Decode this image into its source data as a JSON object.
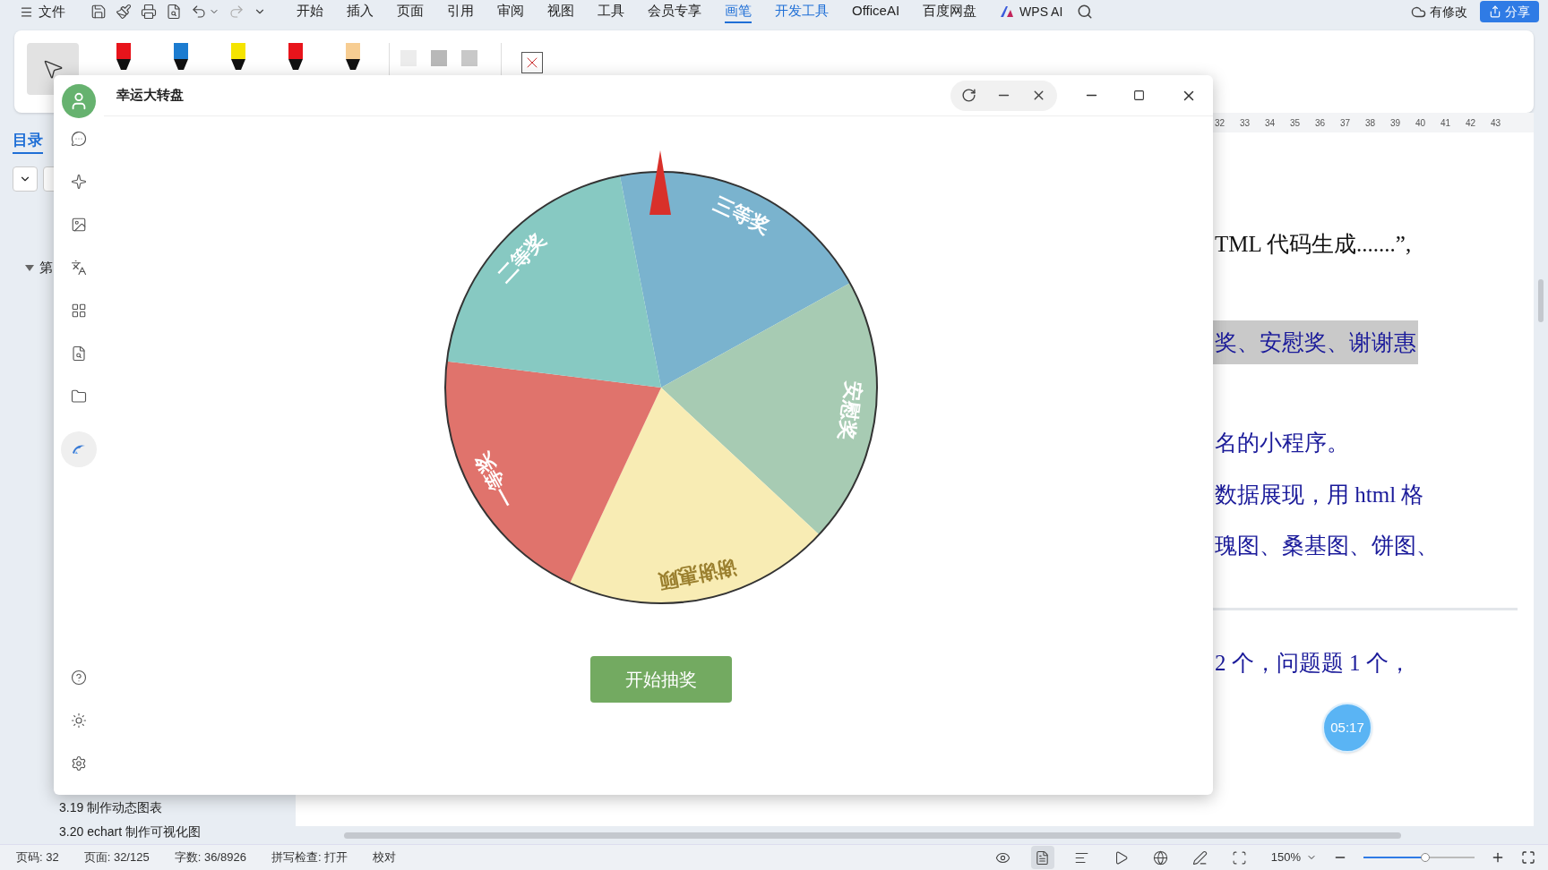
{
  "menu_bar": {
    "file": "文件",
    "menus": [
      {
        "label": "开始",
        "selected": false,
        "accent": false
      },
      {
        "label": "插入",
        "selected": false,
        "accent": false
      },
      {
        "label": "页面",
        "selected": false,
        "accent": false
      },
      {
        "label": "引用",
        "selected": false,
        "accent": false
      },
      {
        "label": "审阅",
        "selected": false,
        "accent": false
      },
      {
        "label": "视图",
        "selected": false,
        "accent": false
      },
      {
        "label": "工具",
        "selected": false,
        "accent": false
      },
      {
        "label": "会员专享",
        "selected": false,
        "accent": false
      },
      {
        "label": "画笔",
        "selected": true,
        "accent": true
      },
      {
        "label": "开发工具",
        "selected": false,
        "accent": true
      },
      {
        "label": "OfficeAI",
        "selected": false,
        "accent": false
      },
      {
        "label": "百度网盘",
        "selected": false,
        "accent": false
      }
    ],
    "ai": "WPS AI",
    "save_status": "有修改",
    "share": "分享"
  },
  "pen_toolbar": {
    "pens": [
      {
        "color": "#e8141b"
      },
      {
        "color": "#1c7cd0"
      },
      {
        "color": "#f5e400"
      },
      {
        "color": "#e8141b"
      },
      {
        "color": "#f7cd92"
      }
    ],
    "swatches": [
      {
        "color": "#ececec"
      },
      {
        "color": "#b8b8b8"
      },
      {
        "color": "#c8c8c8"
      }
    ]
  },
  "outline": {
    "title": "目录",
    "chapter": {
      "label": "第",
      "expanded": true
    },
    "sections": [
      "3.19 制作动态图表",
      "3.20 echart 制作可视化图"
    ]
  },
  "ruler": [
    "32",
    "33",
    "34",
    "35",
    "36",
    "37",
    "38",
    "39",
    "40",
    "41",
    "42",
    "43"
  ],
  "document": {
    "lines": [
      {
        "text": "TML 代码生成.......”,",
        "color": "#111111",
        "highlighted": false,
        "page_break_before": false
      },
      {
        "text": "奖、安慰奖、谢谢惠",
        "color": "#1a1a9a",
        "highlighted": true,
        "page_break_before": false
      },
      {
        "text": "名的小程序。",
        "color": "#1a1a9a",
        "highlighted": false,
        "page_break_before": false
      },
      {
        "text": "数据展现，用 html 格",
        "color": "#1a1a9a",
        "highlighted": false,
        "page_break_before": false
      },
      {
        "text": "瑰图、桑基图、饼图、",
        "color": "#1a1a9a",
        "highlighted": false,
        "page_break_before": false
      },
      {
        "text": "2 个，问题题 1 个，",
        "color": "#1a1a9a",
        "highlighted": false,
        "page_break_before": true
      }
    ],
    "timer": "05:17"
  },
  "dialog": {
    "title": "幸运大转盘",
    "sidebar": [
      {
        "kind": "chat",
        "selected": false
      },
      {
        "kind": "sparkle",
        "selected": false
      },
      {
        "kind": "image",
        "selected": false
      },
      {
        "kind": "translate",
        "selected": false
      },
      {
        "kind": "apps",
        "selected": false
      },
      {
        "kind": "doc-search",
        "selected": false
      },
      {
        "kind": "folder",
        "selected": false
      },
      {
        "kind": "dolphin",
        "selected": true
      }
    ],
    "sidebar_bottom": [
      {
        "kind": "help"
      },
      {
        "kind": "theme"
      },
      {
        "kind": "settings"
      }
    ],
    "wheel": {
      "segments": [
        {
          "label": "三等奖",
          "color": "#7ab3ce"
        },
        {
          "label": "安慰奖",
          "color": "#a7cbb3"
        },
        {
          "label": "谢谢惠顾",
          "color": "#f8ecb4"
        },
        {
          "label": "一等奖",
          "color": "#e0736c"
        },
        {
          "label": "二等奖",
          "color": "#87c9c2"
        }
      ]
    },
    "start_button": "开始抽奖"
  },
  "status_bar": {
    "items": [
      "页码: 32",
      "页面: 32/125",
      "字数: 36/8926",
      "拼写检查: 打开",
      "校对"
    ],
    "views": [
      {
        "kind": "eye",
        "selected": false
      },
      {
        "kind": "page",
        "selected": true
      },
      {
        "kind": "outline",
        "selected": false
      },
      {
        "kind": "play",
        "selected": false
      },
      {
        "kind": "web",
        "selected": false
      },
      {
        "kind": "pen",
        "selected": false
      },
      {
        "kind": "fit",
        "selected": false
      }
    ],
    "zoom": "150%",
    "zoom_slider": {
      "level": 0.56
    }
  }
}
